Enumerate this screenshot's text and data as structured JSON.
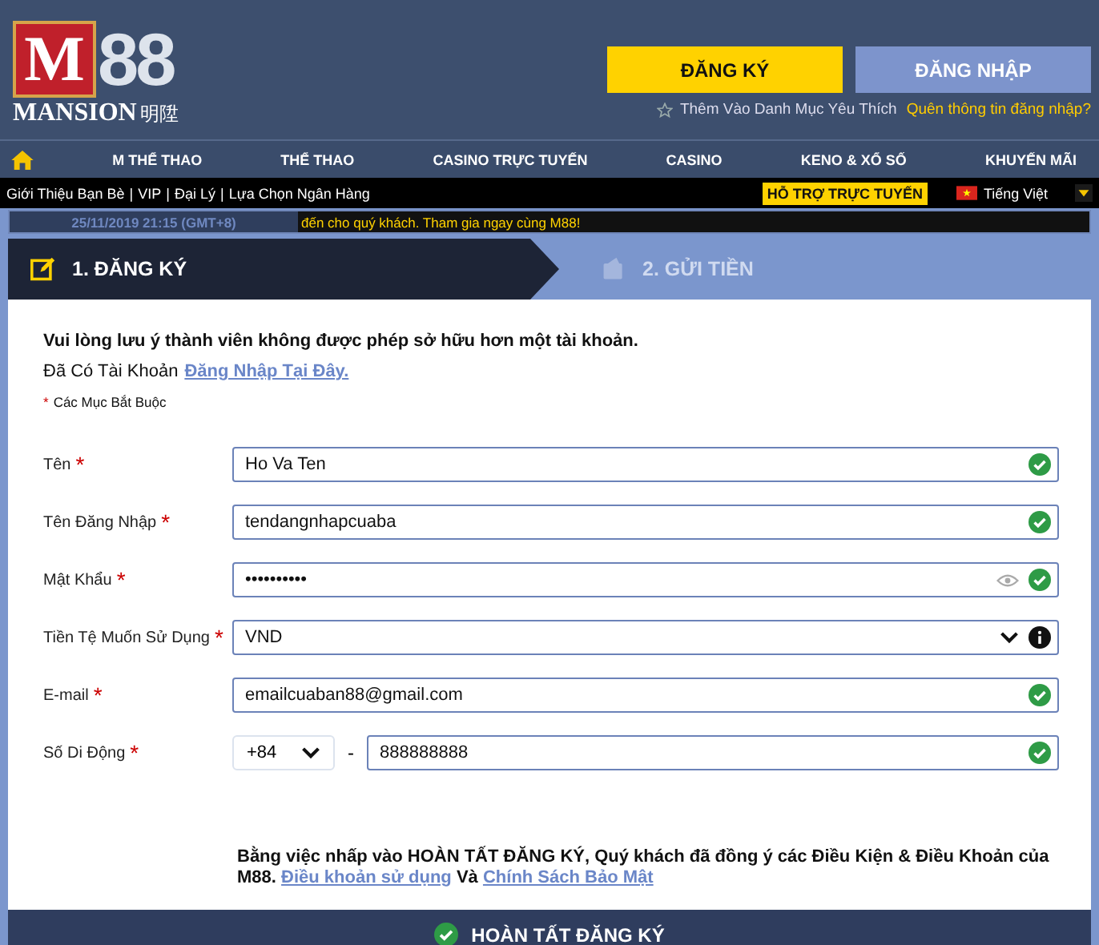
{
  "logo": {
    "letter": "M",
    "number": "88",
    "brand": "MANSION",
    "chinese": "明陞"
  },
  "header": {
    "register_button": "ĐĂNG KÝ",
    "login_button": "ĐĂNG NHẬP",
    "favorite_link": "Thêm Vào Danh Mục Yêu Thích",
    "forgot_link": "Quên thông tin đăng nhập?"
  },
  "nav": [
    "M THỂ THAO",
    "THỂ THAO",
    "CASINO TRỰC TUYẾN",
    "CASINO",
    "KENO & XỔ SỐ",
    "KHUYẾN MÃI"
  ],
  "subbar": {
    "links": [
      "Giới Thiệu Bạn Bè",
      "VIP",
      "Đại Lý",
      "Lựa Chọn Ngân Hàng"
    ],
    "separator": "|",
    "support": "HỖ TRỢ TRỰC TUYẾN",
    "language": "Tiếng Việt"
  },
  "ticker": {
    "time": "25/11/2019 21:15 (GMT+8)",
    "message": "đến cho quý khách. Tham gia ngay cùng M88!"
  },
  "steps": [
    {
      "label": "1. ĐĂNG KÝ",
      "selected": true
    },
    {
      "label": "2. GỬI TIỀN",
      "selected": false
    }
  ],
  "notice": "Vui lòng lưu ý thành viên không được phép sở hữu hơn một tài khoản.",
  "account": {
    "text": "Đã Có Tài Khoản",
    "link": "Đăng Nhập Tại Đây."
  },
  "required_note": {
    "mark": "*",
    "text": "Các Mục Bắt Buộc"
  },
  "fields": [
    {
      "kind": "text",
      "label": "Tên",
      "mark": "*",
      "value": "Ho Va Ten",
      "valid": true
    },
    {
      "kind": "text",
      "label": "Tên Đăng Nhập",
      "mark": "*",
      "value": "tendangnhapcuaba",
      "valid": true
    },
    {
      "kind": "password",
      "label": "Mật Khẩu",
      "mark": "*",
      "value": "••••••••••",
      "valid": true
    },
    {
      "kind": "select",
      "label": "Tiền Tệ Muốn Sử Dụng",
      "mark": "*",
      "value": "VND"
    },
    {
      "kind": "text",
      "label": "E-mail",
      "mark": "*",
      "value": "emailcuaban88@gmail.com",
      "valid": true
    },
    {
      "kind": "phone",
      "label": "Số Di Động",
      "mark": "*",
      "code": "+84",
      "dash": "-",
      "value": "888888888",
      "valid": true
    }
  ],
  "terms": {
    "text": "Bằng việc nhấp vào **HOÀN TẤT ĐĂNG KÝ**, Quý khách đã đồng ý các Điều Kiện & Điều Khoản của M88.",
    "link1": "Điều khoản sử dụng",
    "joiner": "Và",
    "link2": "Chính Sách Bảo Mật"
  },
  "submit": "HOÀN TẤT ĐĂNG KÝ"
}
